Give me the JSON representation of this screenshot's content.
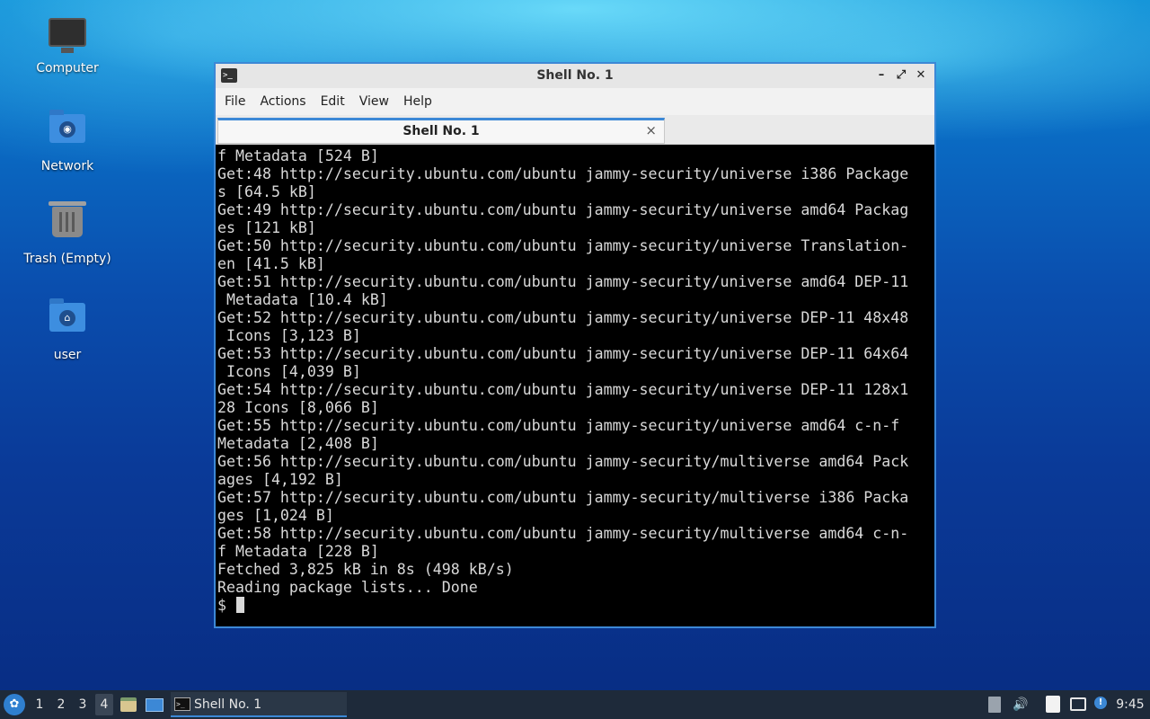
{
  "desktop": {
    "icons": [
      {
        "label": "Computer",
        "icon": "computer-icon"
      },
      {
        "label": "Network",
        "icon": "network-folder-icon"
      },
      {
        "label": "Trash (Empty)",
        "icon": "trash-icon"
      },
      {
        "label": "user",
        "icon": "home-folder-icon"
      }
    ]
  },
  "window": {
    "title": "Shell No. 1",
    "app_icon": ">_",
    "controls": {
      "minimize": "–",
      "maximize": "⤢",
      "close": "✕"
    },
    "menu": [
      "File",
      "Actions",
      "Edit",
      "View",
      "Help"
    ],
    "tab": {
      "label": "Shell No. 1",
      "close": "×"
    },
    "terminal_lines": [
      "f Metadata [524 B]",
      "Get:48 http://security.ubuntu.com/ubuntu jammy-security/universe i386 Package",
      "s [64.5 kB]",
      "Get:49 http://security.ubuntu.com/ubuntu jammy-security/universe amd64 Packag",
      "es [121 kB]",
      "Get:50 http://security.ubuntu.com/ubuntu jammy-security/universe Translation-",
      "en [41.5 kB]",
      "Get:51 http://security.ubuntu.com/ubuntu jammy-security/universe amd64 DEP-11",
      " Metadata [10.4 kB]",
      "Get:52 http://security.ubuntu.com/ubuntu jammy-security/universe DEP-11 48x48",
      " Icons [3,123 B]",
      "Get:53 http://security.ubuntu.com/ubuntu jammy-security/universe DEP-11 64x64",
      " Icons [4,039 B]",
      "Get:54 http://security.ubuntu.com/ubuntu jammy-security/universe DEP-11 128x1",
      "28 Icons [8,066 B]",
      "Get:55 http://security.ubuntu.com/ubuntu jammy-security/universe amd64 c-n-f",
      "Metadata [2,408 B]",
      "Get:56 http://security.ubuntu.com/ubuntu jammy-security/multiverse amd64 Pack",
      "ages [4,192 B]",
      "Get:57 http://security.ubuntu.com/ubuntu jammy-security/multiverse i386 Packa",
      "ges [1,024 B]",
      "Get:58 http://security.ubuntu.com/ubuntu jammy-security/multiverse amd64 c-n-",
      "f Metadata [228 B]",
      "Fetched 3,825 kB in 8s (498 kB/s)",
      "Reading package lists... Done"
    ],
    "prompt": "$ "
  },
  "taskbar": {
    "start_icon": "lubuntu-start-icon",
    "workspaces": [
      "1",
      "2",
      "3",
      "4"
    ],
    "active_workspace": "4",
    "quicklaunch": [
      "file-manager-icon",
      "show-desktop-icon"
    ],
    "task_label": "Shell No. 1",
    "tray_icons": [
      "eject-icon",
      "volume-icon",
      "clipboard-icon",
      "network-icon",
      "update-notifier-icon"
    ],
    "clock": "9:45"
  },
  "colors": {
    "accent": "#3c88d6",
    "taskbar": "#1e2a3a",
    "terminal_bg": "#000000",
    "terminal_fg": "#d9d9d9"
  }
}
